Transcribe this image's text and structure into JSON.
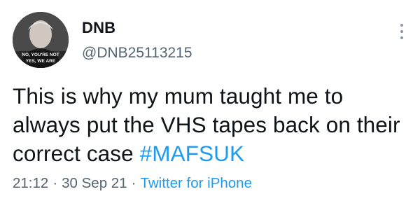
{
  "user": {
    "display_name": "DNB",
    "handle": "@DNB25113215",
    "avatar_caption_line1": "NO, YOU'RE NOT",
    "avatar_caption_line2": "YES, WE ARE"
  },
  "tweet": {
    "text": "This is why my mum taught me to always put the VHS tapes back on their correct case ",
    "hashtag": "#MAFSUK",
    "time": "21:12",
    "separator": "·",
    "date": "30 Sep 21",
    "source": "Twitter for iPhone"
  },
  "icons": {
    "more": "more-vertical-icon"
  },
  "colors": {
    "link": "#1d9bf0",
    "secondary_text": "#536471",
    "primary_text": "#0f1419"
  }
}
